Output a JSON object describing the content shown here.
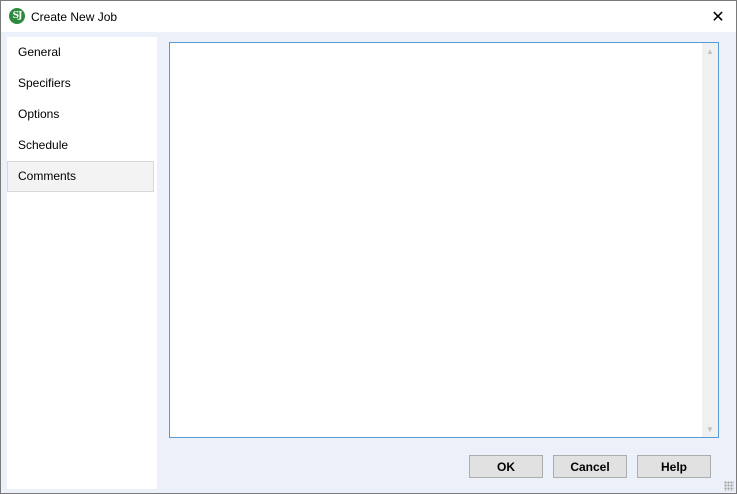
{
  "window": {
    "title": "Create New Job",
    "app_icon_text": "SJ",
    "close_glyph": "✕"
  },
  "sidebar": {
    "items": [
      {
        "label": "General",
        "selected": false
      },
      {
        "label": "Specifiers",
        "selected": false
      },
      {
        "label": "Options",
        "selected": false
      },
      {
        "label": "Schedule",
        "selected": false
      },
      {
        "label": "Comments",
        "selected": true
      }
    ]
  },
  "comments": {
    "value": ""
  },
  "buttons": {
    "ok": "OK",
    "cancel": "Cancel",
    "help": "Help"
  },
  "colors": {
    "accent_border": "#5b9bd5",
    "dialog_background": "#ecf0f8",
    "app_icon": "#2e8b3d"
  }
}
